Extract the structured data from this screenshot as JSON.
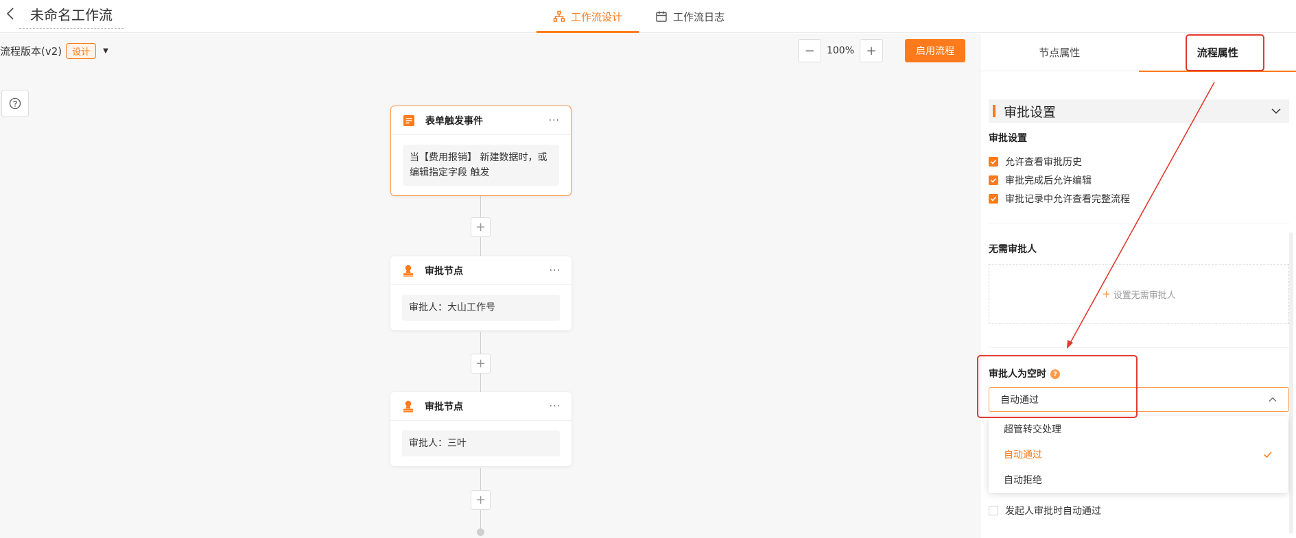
{
  "header": {
    "title": "未命名工作流",
    "tabs": [
      {
        "label": "工作流设计",
        "icon": "flow-icon",
        "active": true
      },
      {
        "label": "工作流日志",
        "icon": "calendar-icon",
        "active": false
      }
    ]
  },
  "canvas": {
    "version_label": "流程版本(v2)",
    "version_badge": "设计",
    "zoom_minus": "−",
    "zoom_value": "100%",
    "zoom_plus": "+",
    "enable_button": "启用流程",
    "add_symbol": "+",
    "more_symbol": "···",
    "nodes": [
      {
        "type": "trigger",
        "title": "表单触发事件",
        "body": "当【费用报销】 新建数据时，或编辑指定字段 触发"
      },
      {
        "type": "approval",
        "title": "审批节点",
        "body": "审批人：大山工作号"
      },
      {
        "type": "approval",
        "title": "审批节点",
        "body": "审批人：三叶"
      }
    ]
  },
  "panel": {
    "tabs": [
      {
        "label": "节点属性",
        "active": false
      },
      {
        "label": "流程属性",
        "active": true
      }
    ],
    "section_title": "审批设置",
    "approval_settings": {
      "title": "审批设置",
      "checkboxes": [
        {
          "label": "允许查看审批历史",
          "checked": true
        },
        {
          "label": "审批完成后允许编辑",
          "checked": true
        },
        {
          "label": "审批记录中允许查看完整流程",
          "checked": true
        }
      ]
    },
    "no_approver": {
      "title": "无需审批人",
      "add_label": "设置无需审批人",
      "add_symbol": "+"
    },
    "empty_approver": {
      "title": "审批人为空时",
      "help_symbol": "?",
      "selected": "自动通过",
      "options": [
        {
          "label": "超管转交处理",
          "selected": false
        },
        {
          "label": "自动通过",
          "selected": true
        },
        {
          "label": "自动拒绝",
          "selected": false
        }
      ]
    },
    "initiator_checkbox": {
      "label": "发起人审批时自动通过",
      "checked": false
    }
  },
  "colors": {
    "accent": "#ff7a1a",
    "annotation": "#e23a2f"
  }
}
